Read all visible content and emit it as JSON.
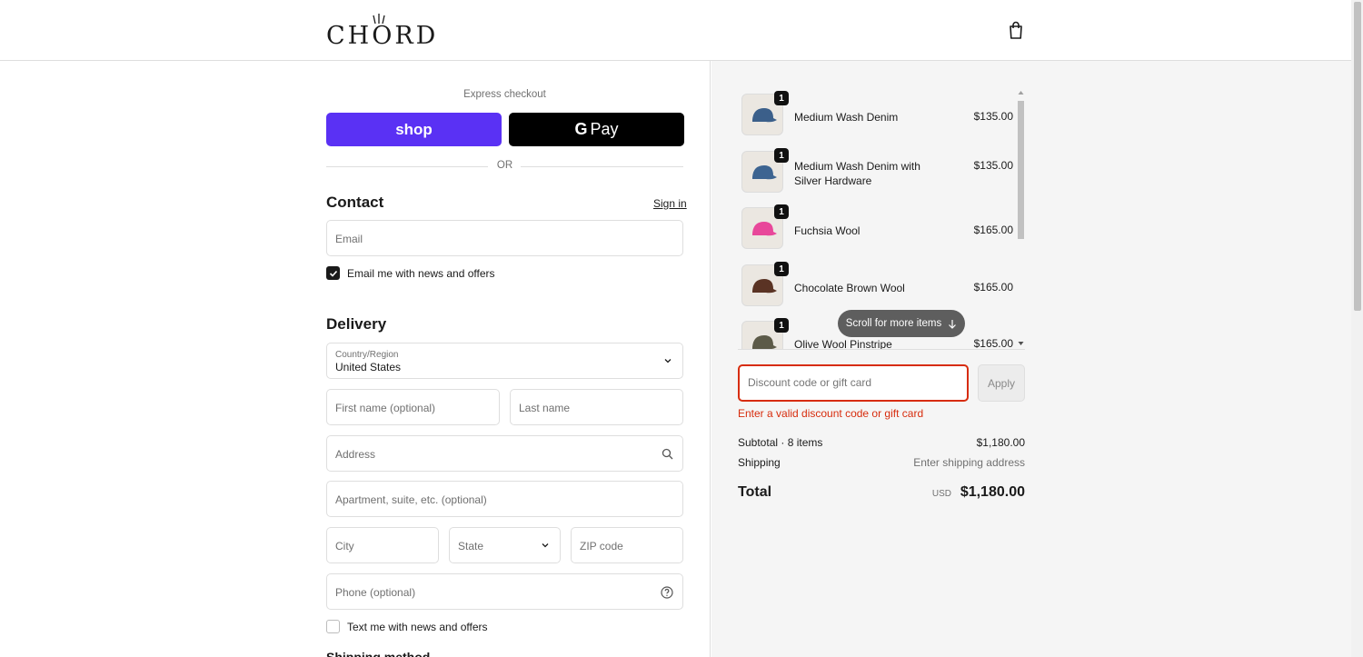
{
  "header": {
    "logo_text": "CHORD",
    "cart_icon": "shopping-bag-icon"
  },
  "express": {
    "label": "Express checkout",
    "shop_label": "shop",
    "gpay_label": "Pay",
    "gpay_g": "G",
    "or_label": "OR"
  },
  "contact": {
    "title": "Contact",
    "sign_in": "Sign in",
    "email_placeholder": "Email",
    "news_checkbox_label": "Email me with news and offers",
    "news_checked": true
  },
  "delivery": {
    "title": "Delivery",
    "country_label": "Country/Region",
    "country_value": "United States",
    "first_name_placeholder": "First name (optional)",
    "last_name_placeholder": "Last name",
    "address_placeholder": "Address",
    "apartment_placeholder": "Apartment, suite, etc. (optional)",
    "city_placeholder": "City",
    "state_placeholder": "State",
    "zip_placeholder": "ZIP code",
    "phone_placeholder": "Phone (optional)",
    "text_checkbox_label": "Text me with news and offers",
    "text_checked": false,
    "next_section_partial": "Shipping method"
  },
  "cart": {
    "items": [
      {
        "name": "Medium Wash Denim",
        "price": "$135.00",
        "qty": "1",
        "color": "#3b5f8a"
      },
      {
        "name": "Medium Wash Denim with Silver Hardware",
        "price": "$135.00",
        "qty": "1",
        "color": "#3d6491"
      },
      {
        "name": "Fuchsia Wool",
        "price": "$165.00",
        "qty": "1",
        "color": "#e8479a"
      },
      {
        "name": "Chocolate Brown Wool",
        "price": "$165.00",
        "qty": "1",
        "color": "#5a3324"
      },
      {
        "name": "Olive Wool Pinstripe",
        "price": "$165.00",
        "qty": "1",
        "color": "#5c5a48"
      }
    ],
    "scroll_hint": "Scroll for more items"
  },
  "discount": {
    "placeholder": "Discount code or gift card",
    "apply_label": "Apply",
    "error": "Enter a valid discount code or gift card"
  },
  "summary": {
    "subtotal_label": "Subtotal · 8 items",
    "subtotal_value": "$1,180.00",
    "shipping_label": "Shipping",
    "shipping_value": "Enter shipping address",
    "total_label": "Total",
    "currency": "USD",
    "total_value": "$1,180.00"
  },
  "colors": {
    "shop_purple": "#5a31f4",
    "error_red": "#d72c0d",
    "panel_bg": "#f5f5f5"
  }
}
